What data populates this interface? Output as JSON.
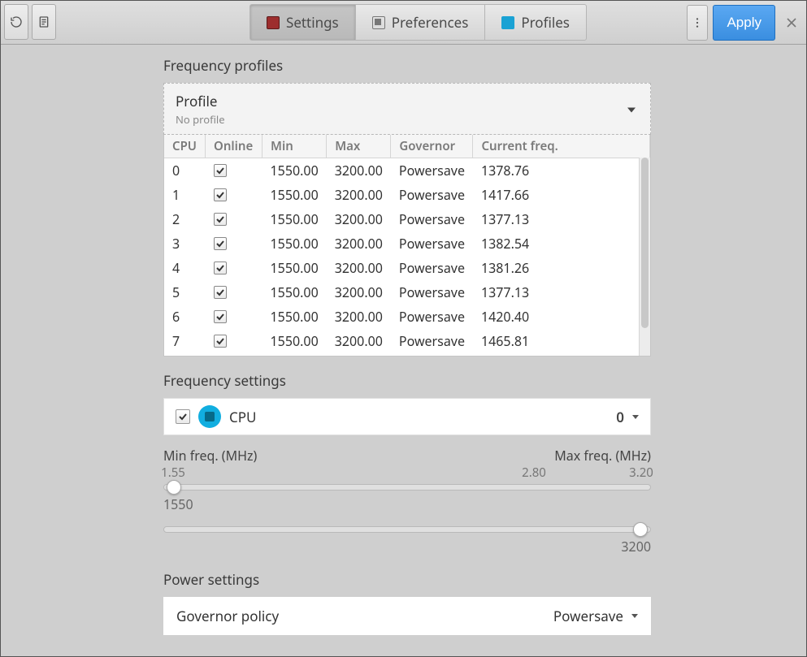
{
  "toolbar": {
    "tabs": [
      {
        "label": "Settings",
        "active": true
      },
      {
        "label": "Preferences",
        "active": false
      },
      {
        "label": "Profiles",
        "active": false
      }
    ],
    "apply_label": "Apply"
  },
  "sections": {
    "freq_profiles_title": "Frequency profiles",
    "freq_settings_title": "Frequency settings",
    "power_settings_title": "Power settings"
  },
  "profile_selector": {
    "label": "Profile",
    "sub": "No profile"
  },
  "cpu_table": {
    "headers": {
      "cpu": "CPU",
      "online": "Online",
      "min": "Min",
      "max": "Max",
      "governor": "Governor",
      "current": "Current freq."
    },
    "rows": [
      {
        "cpu": "0",
        "online": true,
        "min": "1550.00",
        "max": "3200.00",
        "governor": "Powersave",
        "current": "1378.76"
      },
      {
        "cpu": "1",
        "online": true,
        "min": "1550.00",
        "max": "3200.00",
        "governor": "Powersave",
        "current": "1417.66"
      },
      {
        "cpu": "2",
        "online": true,
        "min": "1550.00",
        "max": "3200.00",
        "governor": "Powersave",
        "current": "1377.13"
      },
      {
        "cpu": "3",
        "online": true,
        "min": "1550.00",
        "max": "3200.00",
        "governor": "Powersave",
        "current": "1382.54"
      },
      {
        "cpu": "4",
        "online": true,
        "min": "1550.00",
        "max": "3200.00",
        "governor": "Powersave",
        "current": "1381.26"
      },
      {
        "cpu": "5",
        "online": true,
        "min": "1550.00",
        "max": "3200.00",
        "governor": "Powersave",
        "current": "1377.13"
      },
      {
        "cpu": "6",
        "online": true,
        "min": "1550.00",
        "max": "3200.00",
        "governor": "Powersave",
        "current": "1420.40"
      },
      {
        "cpu": "7",
        "online": true,
        "min": "1550.00",
        "max": "3200.00",
        "governor": "Powersave",
        "current": "1465.81"
      }
    ]
  },
  "cpu_selector": {
    "label": "CPU",
    "value": "0"
  },
  "freq_range": {
    "min_label": "Min freq. (MHz)",
    "max_label": "Max freq. (MHz)",
    "tick_min": "1.55",
    "tick_mid": "2.80",
    "tick_max": "3.20",
    "min_value": "1550",
    "max_value": "3200",
    "min_thumb_pct": 2,
    "max_thumb_pct": 98
  },
  "governor": {
    "label": "Governor policy",
    "value": "Powersave"
  }
}
